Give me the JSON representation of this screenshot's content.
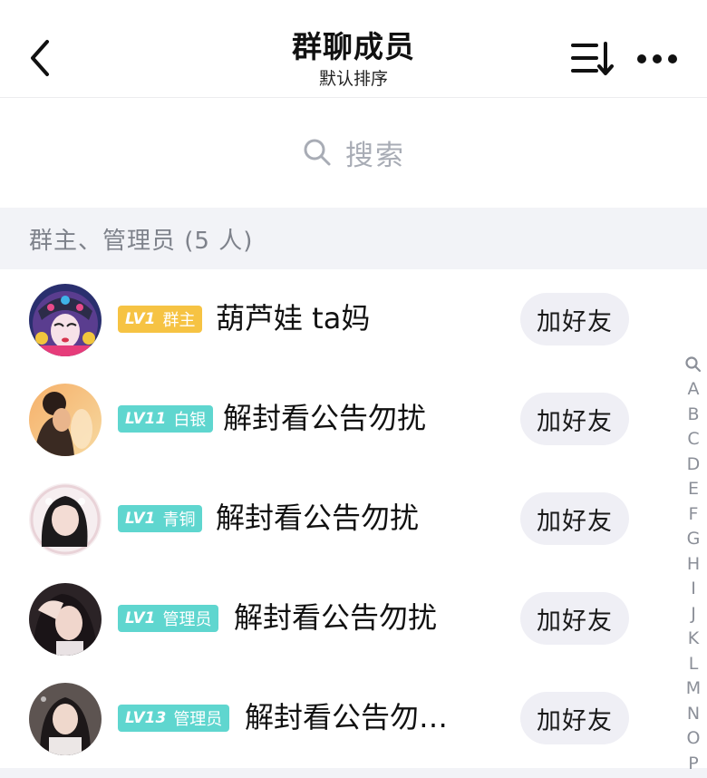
{
  "header": {
    "title": "群聊成员",
    "subtitle": "默认排序"
  },
  "search": {
    "placeholder": "搜索"
  },
  "section": {
    "label": "群主、管理员 (5 人)"
  },
  "members": [
    {
      "level": "LV1",
      "role": "群主",
      "name": "葫芦娃 ta妈",
      "badge_color": "#f6c343",
      "button": "加好友"
    },
    {
      "level": "LV11",
      "role": "白银",
      "name": "解封看公告勿扰",
      "badge_color": "#5fd6cf",
      "button": "加好友"
    },
    {
      "level": "LV1",
      "role": "青铜",
      "name": "解封看公告勿扰",
      "badge_color": "#5fd6cf",
      "button": "加好友"
    },
    {
      "level": "LV1",
      "role": "管理员",
      "name": "解封看公告勿扰",
      "badge_color": "#5fd6cf",
      "button": "加好友"
    },
    {
      "level": "LV13",
      "role": "管理员",
      "name": "解封看公告勿…",
      "badge_color": "#5fd6cf",
      "button": "加好友"
    }
  ],
  "index_bar": {
    "icon": "search-icon",
    "letters": [
      "A",
      "B",
      "C",
      "D",
      "E",
      "F",
      "G",
      "H",
      "I",
      "J",
      "K",
      "L",
      "M",
      "N",
      "O",
      "P"
    ]
  },
  "icons": {
    "back": "chevron-left-icon",
    "sort": "sort-icon",
    "more": "more-dots-icon"
  }
}
